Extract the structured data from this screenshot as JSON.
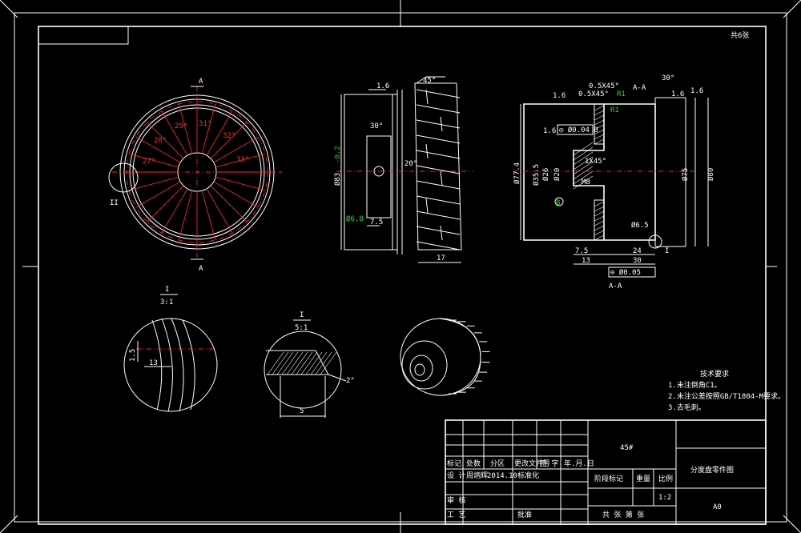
{
  "title_block": {
    "material": "45#",
    "drawing_name": "分度盘零件图",
    "sheet_size": "A0",
    "scale": "1:2",
    "date": "2014.10",
    "labels": {
      "mark": "标记",
      "count": "处数",
      "zone": "分区",
      "change_doc": "更改文件号",
      "sign": "签 字",
      "ymd": "年.月.日",
      "design": "设 计",
      "standardize": "标准化",
      "review": "审 核",
      "process": "工 艺",
      "approve": "批准",
      "stage_mark": "阶段标记",
      "weight": "重量",
      "ratio": "比例",
      "sheets": "共 张 第 张",
      "sign2": "周炳辉"
    }
  },
  "tech_req": {
    "title": "技术要求",
    "items": [
      "1.未注倒角C1。",
      "2.未注公差按照GB/T1804-M要求。",
      "3.去毛刺。"
    ]
  },
  "corner_note": "共6张",
  "views": {
    "front": {
      "section_label": "A",
      "detail_label": "II",
      "angles": [
        "29°",
        "31°",
        "32°",
        "33°",
        "28°",
        "27°"
      ]
    },
    "side": {
      "roughness": "1.6",
      "angle_top": "45°",
      "angle_slot": "30°",
      "angle_mid": "20°",
      "dim_dia": "Ø83",
      "dim_dia_tol": "-0.2",
      "dim_hole": "Ø6.8",
      "dim_75": "7.5",
      "dim_17": "17"
    },
    "section": {
      "title": "A-A",
      "bottom_title": "A-A",
      "chamfer1": "0.5X45°",
      "chamfer2": "0.5X45°",
      "r1a": "R1",
      "r1b": "R1",
      "angle": "30°",
      "tol_frame": "◎ Ø0.04 B",
      "d77": "Ø77.4",
      "d35": "Ø35.5",
      "d26": "Ø26",
      "d20": "Ø20",
      "d75": "Ø75",
      "d80": "Ø80",
      "m8": "M8",
      "c1": "1X45°",
      "d65": "Ø6.5",
      "l75": "7.5",
      "l13": "13",
      "l24": "24",
      "l30": "30",
      "flatness": "⊖ Ø0.05",
      "label_i": "I",
      "label_b": "B",
      "r16": "1.6",
      "r16b": "1.6",
      "r16c": "1.6",
      "r16d": "1.6"
    },
    "detail1": {
      "num": "I",
      "den": "3:1",
      "d15": "1.5",
      "d13": "13"
    },
    "detail2": {
      "num": "I",
      "den": "5:1",
      "d5": "5",
      "ang": "2°"
    }
  },
  "colors": {
    "line": "#ffffff",
    "center": "#ff2020",
    "dim": "#22dd22",
    "bg": "#000000"
  }
}
